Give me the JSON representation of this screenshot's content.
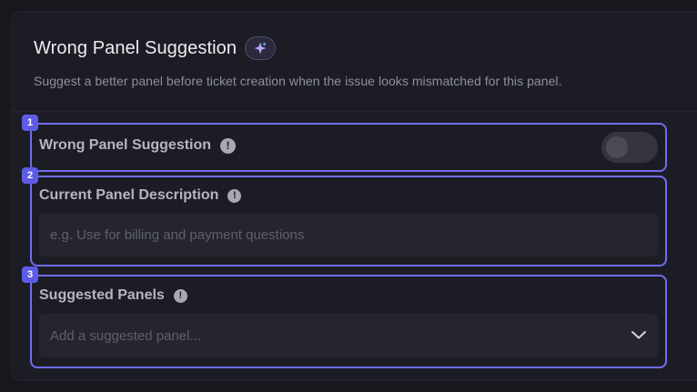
{
  "header": {
    "title": "Wrong Panel Suggestion",
    "description": "Suggest a better panel before ticket creation when the issue looks mismatched for this panel.",
    "ai_icon": "sparkle-icon"
  },
  "sections": [
    {
      "number": "1",
      "label": "Wrong Panel Suggestion",
      "control": "toggle",
      "toggle_on": false
    },
    {
      "number": "2",
      "label": "Current Panel Description",
      "control": "text-input",
      "placeholder": "e.g. Use for billing and payment questions"
    },
    {
      "number": "3",
      "label": "Suggested Panels",
      "control": "select",
      "placeholder": "Add a suggested panel..."
    }
  ],
  "info_icon_glyph": "!",
  "colors": {
    "accent": "#6f6df2",
    "badge": "#5e5ce6",
    "background": "#17181d",
    "card": "#1c1d24"
  }
}
